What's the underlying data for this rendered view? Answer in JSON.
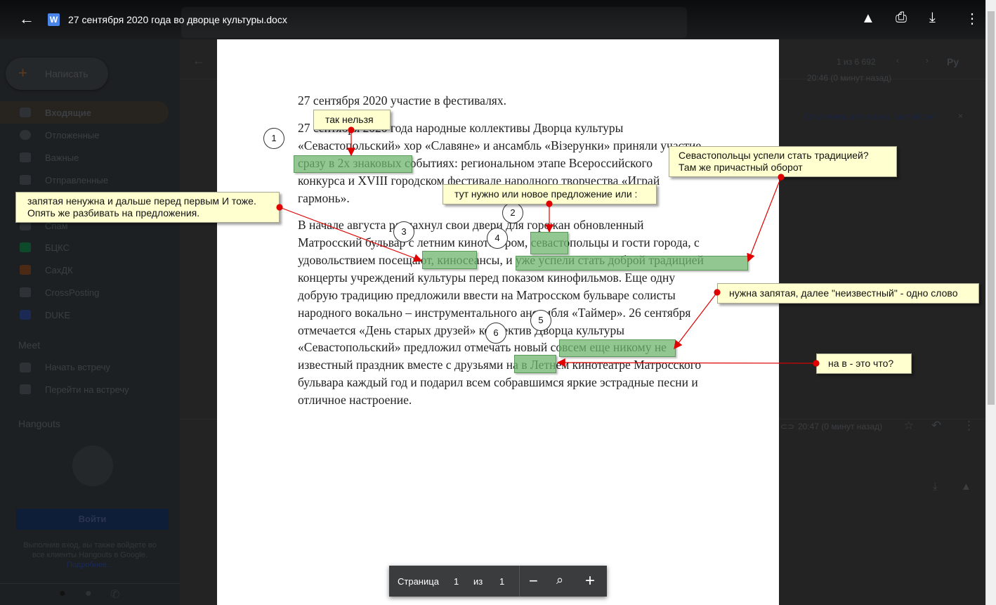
{
  "header": {
    "title": "27 сентября 2020 года во дворце культуры.docx",
    "icons": [
      "back-arrow-icon",
      "word-icon",
      "add-to-drive-icon",
      "print-icon",
      "download-icon",
      "more-icon"
    ]
  },
  "gmail": {
    "compose": "Написать",
    "nav": [
      "Входящие",
      "Отложенные",
      "Важные",
      "Отправленные",
      "Спам",
      "БЦКС",
      "СахДК",
      "CrossPosting",
      "DUKE"
    ],
    "label_colors": {
      "БЦКС": "#0d4a2a",
      "СахДК": "#4a2a14",
      "CrossPosting": "#2a2e32",
      "DUKE": "#1a2a55"
    },
    "meet_title": "Meet",
    "meet": [
      "Начать встречу",
      "Перейти на встречу"
    ],
    "hangouts_title": "Hangouts",
    "signin": "Войти",
    "signin_note_1": "Выполнив вход, вы также войдете во",
    "signin_note_2": "все клиенты Hangouts в Google.",
    "more_link": "Подробнее...",
    "pager": "1 из 6 692",
    "lang": "Ру",
    "translate_off": "Отключить для языка: английский",
    "close": "×",
    "time_1": "20:46 (0 минут назад)",
    "time_2": "20:47 (0 минут назад)"
  },
  "document": {
    "lines": [
      "27 сентября 2020 участие в фестивалях.",
      "27 сентября 2020 года народные коллективы Дворца культуры",
      "«Севастопольский» хор «Славяне» и ансамбль «Візерунки» приняли участие",
      "сразу в 2х знаковых событиях: региональном этапе Всероссийского",
      "конкурса и XVIII городском фестивале народного творчества «Играй",
      "гармонь».",
      "В начале августа распахнул свои двери для горожан обновленный",
      "Матросский бульвар с летним кинотеатром, севастопольцы и гости города, с",
      "удовольствием посещают, киносеансы, и уже успели стать доброй традицией",
      "концерты учреждений культуры перед показом кинофильмов. Еще одну",
      "добрую традицию предложили ввести на Матросском бульваре солисты",
      "народного вокально – инструментального ансамбля «Таймер». 26 сентября",
      "отмечается «День старых друзей» коллектив Дворца культуры",
      "«Севастопольский» предложил отмечать новый совсем еще никому не",
      "известный праздник вместе с друзьями на в Летнем кинотеатре Матросского",
      "бульвара каждый год и подарил всем собравшимся яркие эстрадные песни и",
      "отличное настроение."
    ]
  },
  "annotations": {
    "notes": [
      "так нельзя",
      "Севастопольцы успели стать традицией?",
      "Там же причастный оборот",
      "тут нужно или новое предложение или :",
      "запятая ненужна и дальше перед первым И тоже.",
      "Опять же разбивать на предложения.",
      "нужна запятая, далее \"неизвестный\" - одно слово",
      "на в - это что?"
    ],
    "numbers": [
      "1",
      "2",
      "3",
      "4",
      "5",
      "6"
    ],
    "highlight_color": "#6eb46e",
    "note_color": "#ffffd0",
    "arrow_color": "#e00000"
  },
  "viewer_toolbar": {
    "page_label": "Страница",
    "page": "1",
    "of": "из",
    "total": "1"
  }
}
